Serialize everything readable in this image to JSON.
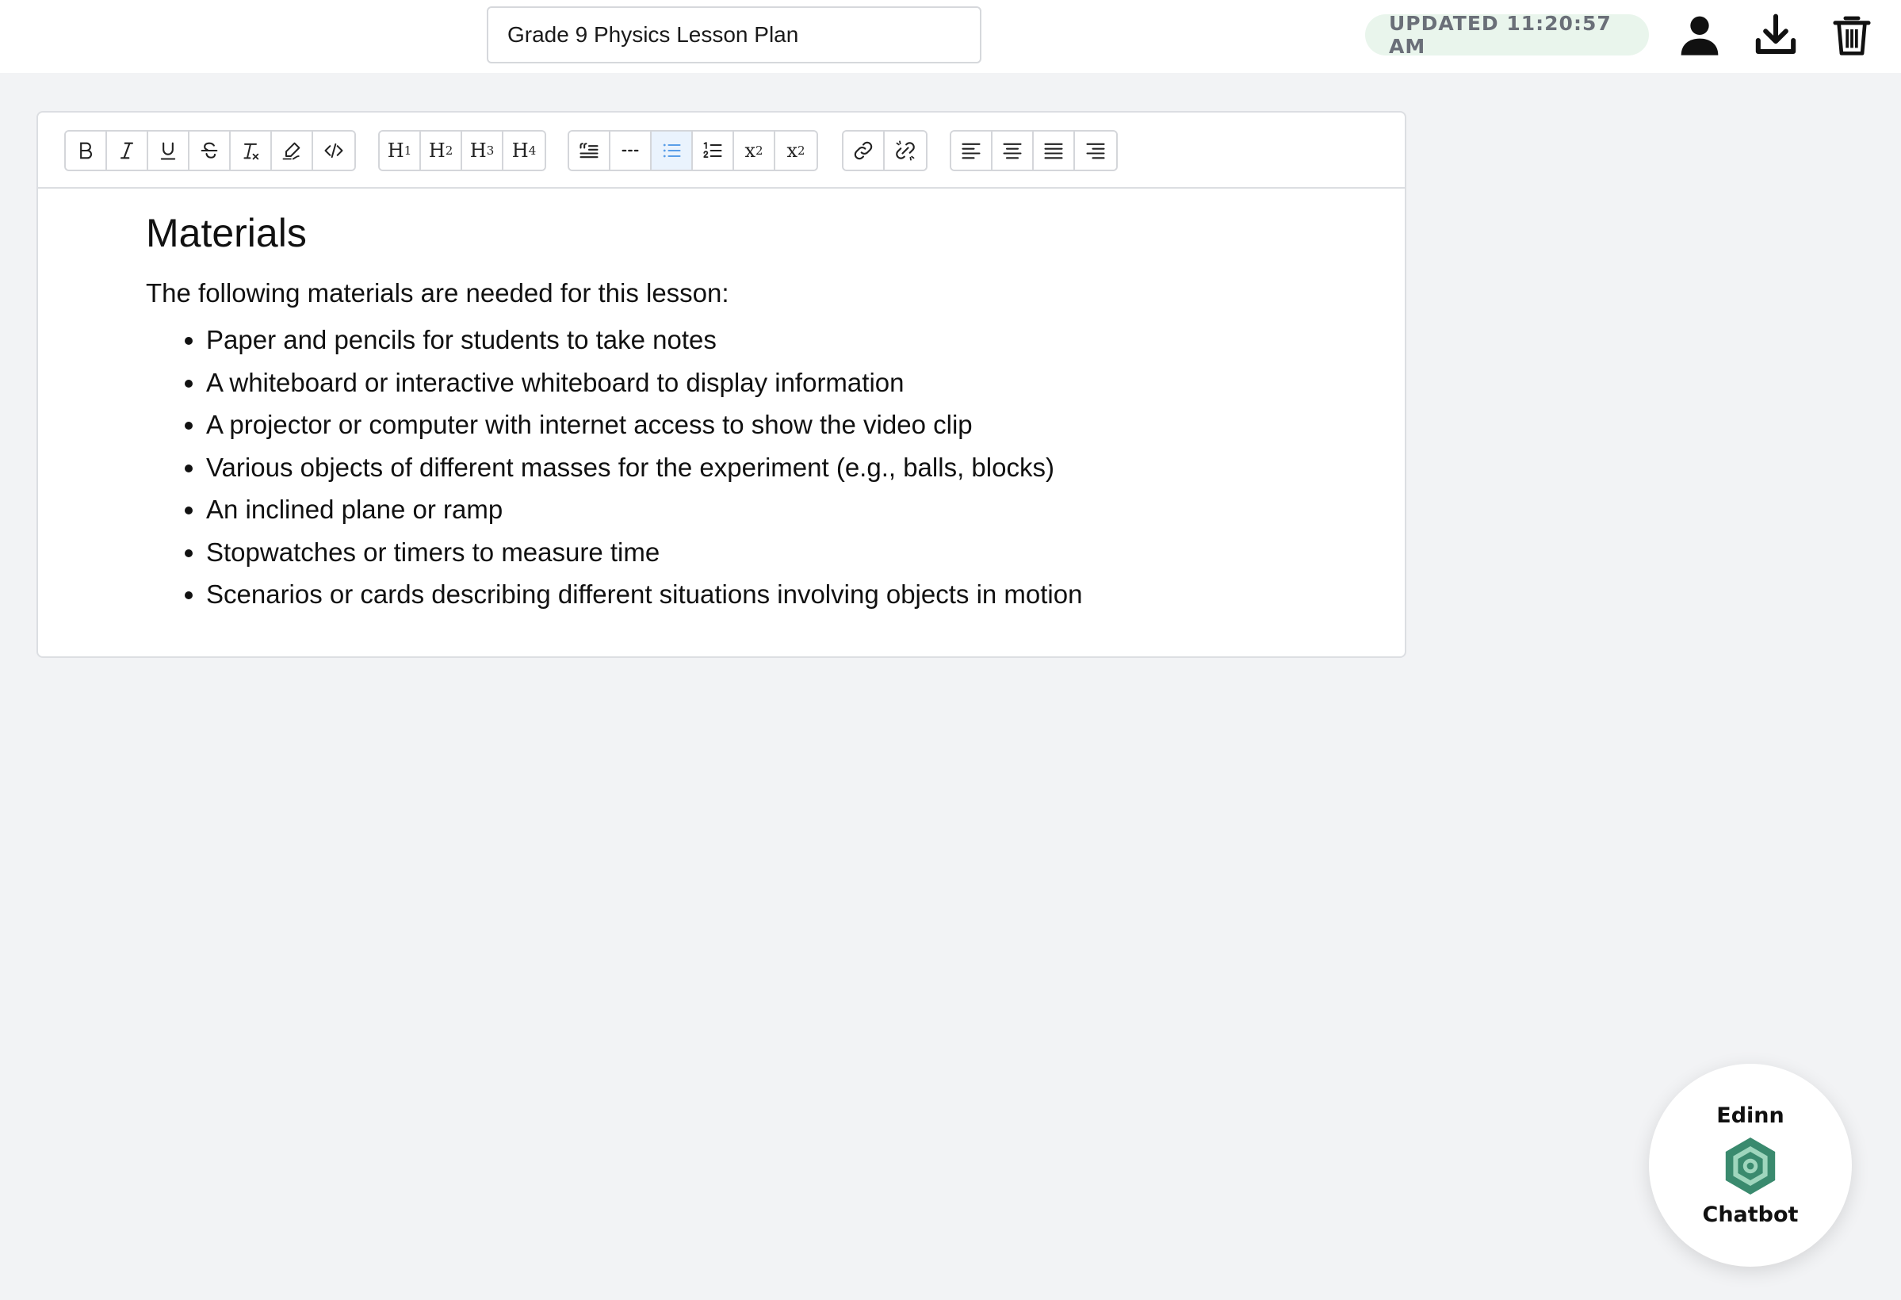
{
  "header": {
    "document_title": "Grade 9 Physics Lesson Plan",
    "status": "UPDATED 11:20:57 AM",
    "icons": [
      "user-icon",
      "download-icon",
      "trash-icon"
    ]
  },
  "toolbar": {
    "groups": [
      [
        "bold-icon",
        "italic-icon",
        "underline-icon",
        "strikethrough-icon",
        "clear-format-icon",
        "highlight-icon",
        "code-icon"
      ],
      [
        "H1",
        "H2",
        "H3",
        "H4"
      ],
      [
        "blockquote-icon",
        "horizontal-rule-icon",
        "bullet-list-icon",
        "ordered-list-icon",
        "subscript-icon",
        "superscript-icon"
      ],
      [
        "link-icon",
        "unlink-icon"
      ],
      [
        "align-left-icon",
        "align-center-icon",
        "align-justify-icon",
        "align-right-icon"
      ]
    ],
    "active": "bullet-list-icon",
    "h1": {
      "letter": "H",
      "num": "1"
    },
    "h2": {
      "letter": "H",
      "num": "2"
    },
    "h3": {
      "letter": "H",
      "num": "3"
    },
    "h4": {
      "letter": "H",
      "num": "4"
    },
    "subscript": {
      "base": "x",
      "mark": "2"
    },
    "superscript": {
      "base": "x",
      "mark": "2"
    }
  },
  "document": {
    "heading": "Materials",
    "intro": "The following materials are needed for this lesson:",
    "items": [
      "Paper and pencils for students to take notes",
      "A whiteboard or interactive whiteboard to display information",
      "A projector or computer with internet access to show the video clip",
      "Various objects of different masses for the experiment (e.g., balls, blocks)",
      "An inclined plane or ramp",
      "Stopwatches or timers to measure time",
      "Scenarios or cards describing different situations involving objects in motion"
    ]
  },
  "chatbot": {
    "top_label": "Edinn",
    "bottom_label": "Chatbot",
    "accent": "#3a8a6e"
  },
  "colors": {
    "background": "#f2f3f5",
    "badge_bg": "#e9f5ec",
    "active_tool": "#eaf3fd"
  }
}
